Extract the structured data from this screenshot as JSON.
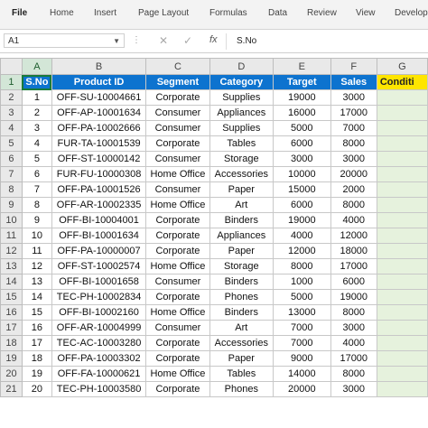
{
  "ribbon": {
    "tabs": [
      "File",
      "Home",
      "Insert",
      "Page Layout",
      "Formulas",
      "Data",
      "Review",
      "View",
      "Develop"
    ]
  },
  "formula_bar": {
    "name_box": "A1",
    "fx": "fx",
    "content": "S.No"
  },
  "grid": {
    "column_letters": [
      "A",
      "B",
      "C",
      "D",
      "E",
      "F",
      "G"
    ],
    "row_numbers": [
      "1",
      "2",
      "3",
      "4",
      "5",
      "6",
      "7",
      "8",
      "9",
      "10",
      "11",
      "12",
      "13",
      "14",
      "15",
      "16",
      "17",
      "18",
      "19",
      "20",
      "21"
    ],
    "headers": [
      "S.No",
      "Product ID",
      "Segment",
      "Category",
      "Target",
      "Sales",
      "Conditi"
    ],
    "rows": [
      [
        "1",
        "OFF-SU-10004661",
        "Corporate",
        "Supplies",
        "19000",
        "3000",
        ""
      ],
      [
        "2",
        "OFF-AP-10001634",
        "Consumer",
        "Appliances",
        "16000",
        "17000",
        ""
      ],
      [
        "3",
        "OFF-PA-10002666",
        "Consumer",
        "Supplies",
        "5000",
        "7000",
        ""
      ],
      [
        "4",
        "FUR-TA-10001539",
        "Corporate",
        "Tables",
        "6000",
        "8000",
        ""
      ],
      [
        "5",
        "OFF-ST-10000142",
        "Consumer",
        "Storage",
        "3000",
        "3000",
        ""
      ],
      [
        "6",
        "FUR-FU-10000308",
        "Home Office",
        "Accessories",
        "10000",
        "20000",
        ""
      ],
      [
        "7",
        "OFF-PA-10001526",
        "Consumer",
        "Paper",
        "15000",
        "2000",
        ""
      ],
      [
        "8",
        "OFF-AR-10002335",
        "Home Office",
        "Art",
        "6000",
        "8000",
        ""
      ],
      [
        "9",
        "OFF-BI-10004001",
        "Corporate",
        "Binders",
        "19000",
        "4000",
        ""
      ],
      [
        "10",
        "OFF-BI-10001634",
        "Corporate",
        "Appliances",
        "4000",
        "12000",
        ""
      ],
      [
        "11",
        "OFF-PA-10000007",
        "Corporate",
        "Paper",
        "12000",
        "18000",
        ""
      ],
      [
        "12",
        "OFF-ST-10002574",
        "Home Office",
        "Storage",
        "8000",
        "17000",
        ""
      ],
      [
        "13",
        "OFF-BI-10001658",
        "Consumer",
        "Binders",
        "1000",
        "6000",
        ""
      ],
      [
        "14",
        "TEC-PH-10002834",
        "Corporate",
        "Phones",
        "5000",
        "19000",
        ""
      ],
      [
        "15",
        "OFF-BI-10002160",
        "Home Office",
        "Binders",
        "13000",
        "8000",
        ""
      ],
      [
        "16",
        "OFF-AR-10004999",
        "Consumer",
        "Art",
        "7000",
        "3000",
        ""
      ],
      [
        "17",
        "TEC-AC-10003280",
        "Corporate",
        "Accessories",
        "7000",
        "4000",
        ""
      ],
      [
        "18",
        "OFF-PA-10003302",
        "Corporate",
        "Paper",
        "9000",
        "17000",
        ""
      ],
      [
        "19",
        "OFF-FA-10000621",
        "Home Office",
        "Tables",
        "14000",
        "8000",
        ""
      ],
      [
        "20",
        "TEC-PH-10003580",
        "Corporate",
        "Phones",
        "20000",
        "3000",
        ""
      ]
    ]
  },
  "colors": {
    "header_blue": "#0d73cf",
    "header_yellow": "#ffe500",
    "condition_column_fill": "#e6f2dd",
    "selected_green": "#1a7a3a"
  }
}
